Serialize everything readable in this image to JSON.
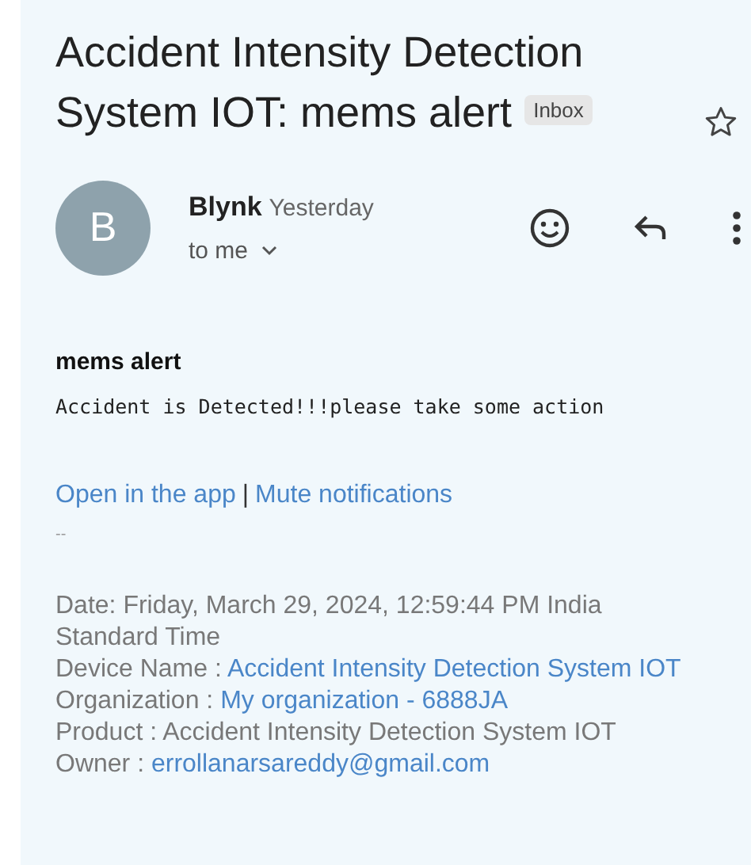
{
  "subject": "Accident Intensity Detection System IOT: mems alert",
  "label": "Inbox",
  "starred": false,
  "sender": {
    "avatar": "B",
    "name": "Blynk",
    "time": "Yesterday",
    "recipient": "to me"
  },
  "body": {
    "heading": "mems alert",
    "message": "Accident is Detected!!!please take some action",
    "links": [
      "Open in the app",
      "Mute notifications"
    ],
    "separator": "|",
    "signature_dash": "--",
    "details": [
      {
        "kind": "text",
        "text": "Date: Friday, March 29, 2024, 12:59:44 PM India Standard Time"
      },
      {
        "kind": "link",
        "label": "Device Name :",
        "value": "Accident Intensity Detection System IOT"
      },
      {
        "kind": "link",
        "label": "Organization :",
        "value": "My organization - 6888JA"
      },
      {
        "kind": "text",
        "text": "Product : Accident Intensity Detection System IOT"
      },
      {
        "kind": "link",
        "label": "Owner :",
        "value": "errollanarsareddy@gmail.com"
      }
    ]
  }
}
